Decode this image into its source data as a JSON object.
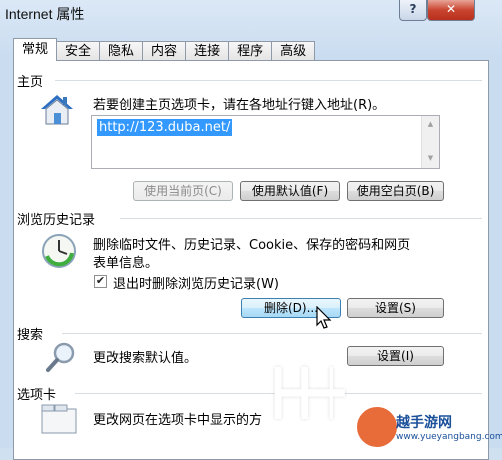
{
  "window": {
    "title": "Internet 属性",
    "help_label": "?",
    "close_label": "✕"
  },
  "tabs": [
    {
      "label": "常规",
      "active": true
    },
    {
      "label": "安全"
    },
    {
      "label": "隐私"
    },
    {
      "label": "内容"
    },
    {
      "label": "连接"
    },
    {
      "label": "程序"
    },
    {
      "label": "高级"
    }
  ],
  "homepage": {
    "section_label": "主页",
    "description": "若要创建主页选项卡，请在各地址行键入地址(R)。",
    "address_value": "http://123.duba.net/",
    "buttons": {
      "use_current": "使用当前页(C)",
      "use_default": "使用默认值(F)",
      "use_blank": "使用空白页(B)"
    }
  },
  "history": {
    "section_label": "浏览历史记录",
    "description_line1": "删除临时文件、历史记录、Cookie、保存的密码和网页",
    "description_line2": "表单信息。",
    "checkbox_label": "退出时删除浏览历史记录(W)",
    "checkbox_checked": true,
    "delete_button": "删除(D)...",
    "settings_button": "设置(S)"
  },
  "search": {
    "section_label": "搜索",
    "description": "更改搜索默认值。",
    "settings_button": "设置(I)"
  },
  "tabs_section": {
    "section_label": "选项卡",
    "description": "更改网页在选项卡中显示的方"
  },
  "watermark": {
    "brand": "越手游网",
    "url": "www.yueyangbang.com"
  },
  "colors": {
    "selection": "#3399ff",
    "window_frame": "#c9dcf0",
    "close_button": "#c94530"
  },
  "icons": {
    "homepage": "house-icon",
    "history": "clock-icon",
    "search": "magnifier-icon",
    "tabs": "tabs-window-icon"
  }
}
